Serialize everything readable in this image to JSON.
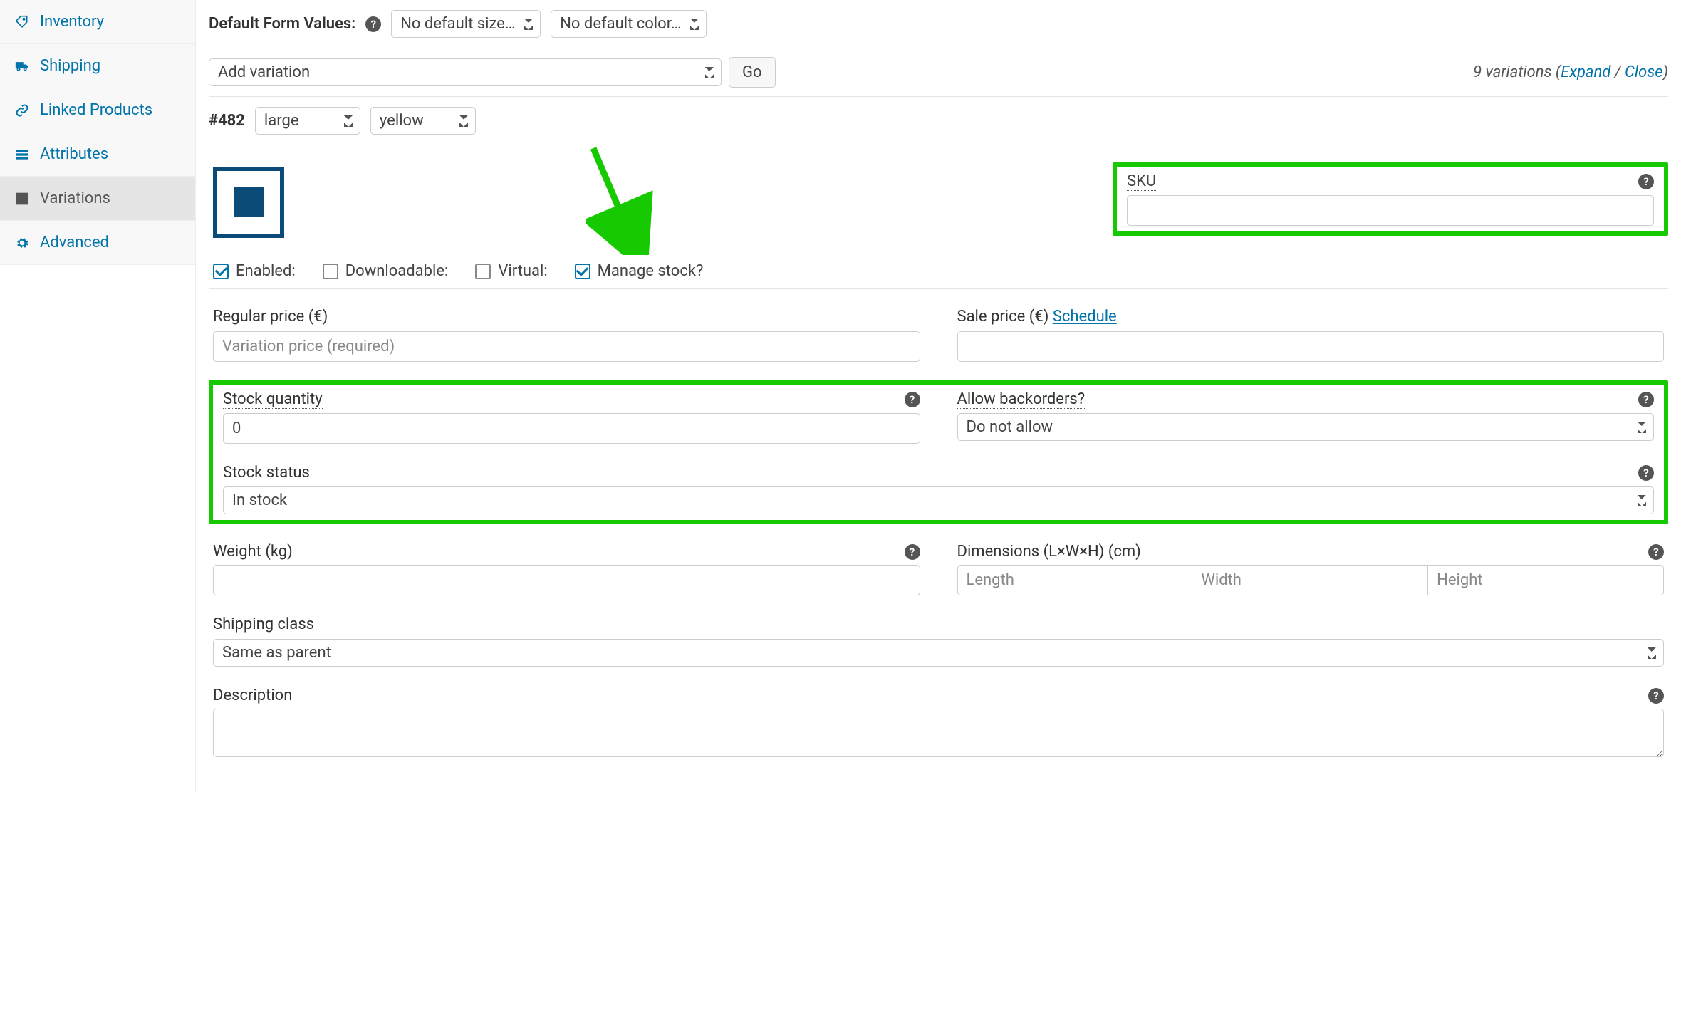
{
  "sidebar": {
    "items": [
      {
        "label": "Inventory"
      },
      {
        "label": "Shipping"
      },
      {
        "label": "Linked Products"
      },
      {
        "label": "Attributes"
      },
      {
        "label": "Variations"
      },
      {
        "label": "Advanced"
      }
    ]
  },
  "defaults": {
    "label": "Default Form Values:",
    "size": "No default size…",
    "color": "No default color…"
  },
  "actions": {
    "add_variation": "Add variation",
    "go": "Go"
  },
  "toolbar": {
    "count": "9",
    "variations_word": "variations",
    "expand": "Expand",
    "sep": " / ",
    "close": "Close"
  },
  "variation": {
    "id": "#482",
    "size": "large",
    "color": "yellow"
  },
  "fields": {
    "sku_label": "SKU",
    "sku_value": "",
    "enabled": "Enabled:",
    "downloadable": "Downloadable:",
    "virtual": "Virtual:",
    "manage_stock": "Manage stock?",
    "regular_price_label": "Regular price (€)",
    "regular_price_placeholder": "Variation price (required)",
    "sale_price_label": "Sale price (€) ",
    "schedule": "Schedule",
    "stock_qty_label": "Stock quantity",
    "stock_qty_value": "0",
    "backorders_label": "Allow backorders?",
    "backorders_value": "Do not allow",
    "stock_status_label": "Stock status",
    "stock_status_value": "In stock",
    "weight_label": "Weight (kg)",
    "dimensions_label": "Dimensions (L×W×H) (cm)",
    "dim_length": "Length",
    "dim_width": "Width",
    "dim_height": "Height",
    "shipping_class_label": "Shipping class",
    "shipping_class_value": "Same as parent",
    "description_label": "Description"
  }
}
